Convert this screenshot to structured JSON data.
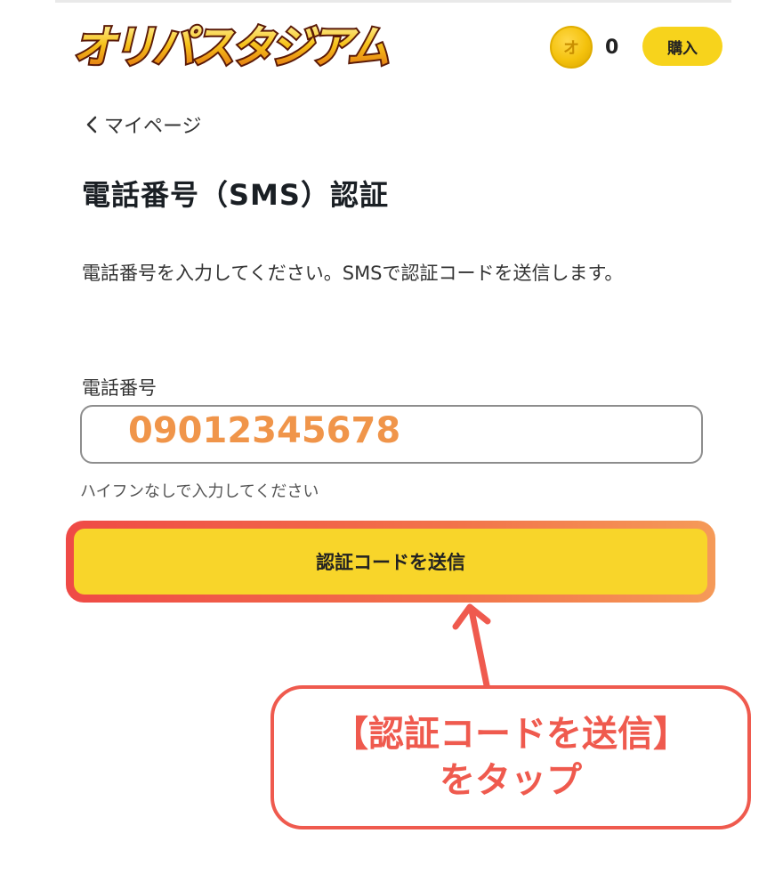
{
  "header": {
    "logo_text": "オリパスタジアム",
    "coin_symbol": "オ",
    "coin_count": "0",
    "buy_label": "購入"
  },
  "nav": {
    "back_label": "マイページ"
  },
  "page": {
    "title": "電話番号（SMS）認証",
    "description": "電話番号を入力してください。SMSで認証コードを送信します。",
    "phone_label": "電話番号",
    "phone_value": "09012345678",
    "hint": "ハイフンなしで入力してください",
    "submit_label": "認証コードを送信"
  },
  "annotation": {
    "line1": "【認証コードを送信】",
    "line2": "をタップ"
  },
  "colors": {
    "accent_yellow": "#f8d52a",
    "highlight_red": "#ef4a46",
    "phone_value_orange": "#f0954a"
  }
}
